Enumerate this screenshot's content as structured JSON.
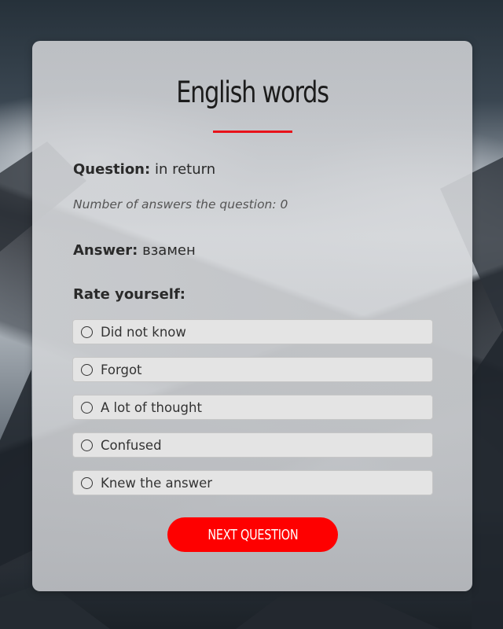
{
  "card": {
    "title": "English words"
  },
  "question": {
    "label": "Question:",
    "value": "in return"
  },
  "answers_count": {
    "text": "Number of answers the question: 0"
  },
  "answer": {
    "label": "Answer:",
    "value": "взамен"
  },
  "rate": {
    "label": "Rate yourself:",
    "options": [
      {
        "label": "Did not know"
      },
      {
        "label": "Forgot"
      },
      {
        "label": "A lot of thought"
      },
      {
        "label": "Confused"
      },
      {
        "label": "Knew the answer"
      }
    ]
  },
  "actions": {
    "next_label": "NEXT QUESTION"
  },
  "colors": {
    "accent": "#fe0000",
    "underline": "#e8121a",
    "card_bg": "#d2d3d6",
    "option_bg": "#e4e4e4"
  }
}
